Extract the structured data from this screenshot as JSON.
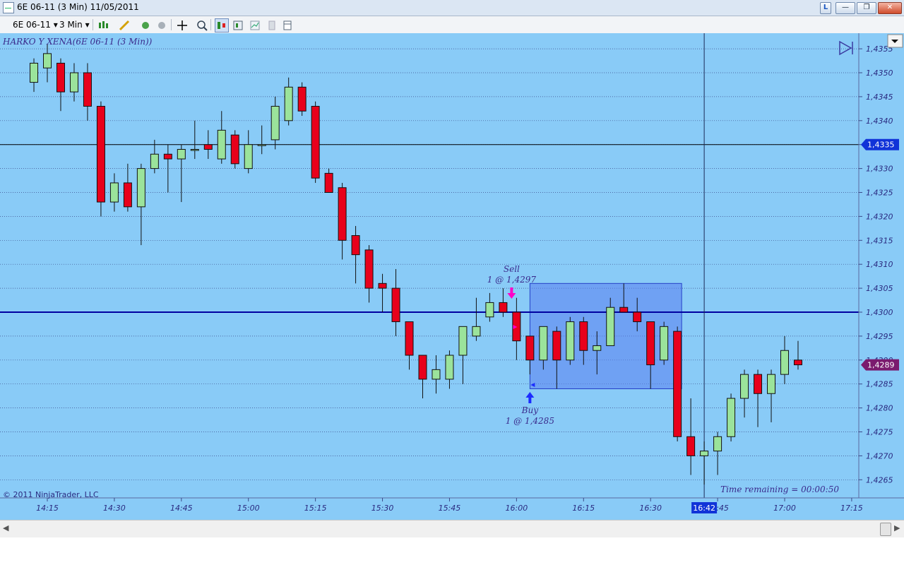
{
  "window": {
    "title": "6E 06-11 (3 Min)  11/05/2011",
    "buttons": {
      "l": "L",
      "minimize": "—",
      "restore": "❐",
      "close": "✕"
    }
  },
  "toolbar": {
    "instrument": "6E 06-11",
    "interval": "3 Min",
    "dropdown_arrow": "▾"
  },
  "chart": {
    "label": "HARKO Y XENA(6E 06-11 (3 Min))",
    "copyright": "© 2011 NinjaTrader, LLC",
    "time_remaining": "Time remaining = 00:00:50",
    "crosshair_time_tag": "16:42",
    "price_tags": {
      "black_line": "1,4335",
      "last_price": "1,4289"
    },
    "y_ticks": [
      "1,4355",
      "1,4350",
      "1,4345",
      "1,4340",
      "1,4335",
      "1,4330",
      "1,4325",
      "1,4320",
      "1,4315",
      "1,4310",
      "1,4305",
      "1,4300",
      "1,4295",
      "1,4290",
      "1,4285",
      "1,4280",
      "1,4275",
      "1,4270",
      "1,4265"
    ],
    "x_ticks": [
      "14:15",
      "14:30",
      "14:45",
      "15:00",
      "15:15",
      "15:30",
      "15:45",
      "16:00",
      "16:15",
      "16:30",
      "16:45",
      "17:00",
      "17:15"
    ],
    "sell_marker": {
      "title": "Sell",
      "detail": "1 @ 1,4297"
    },
    "buy_marker": {
      "title": "Buy",
      "detail": "1 @ 1,4285"
    },
    "colors": {
      "background": "#89cbf7",
      "up_candle": "#9be39b",
      "down_candle": "#e8001b",
      "horizontal_line_black": "#000000",
      "horizontal_line_blue": "#0000a0",
      "zone_fill": "#5a7ff0",
      "price_tag_blue": "#1033d8",
      "price_tag_purple": "#7a1a6e",
      "sell_arrow": "#ff00c8",
      "buy_arrow": "#1c2cff",
      "text_purple": "#3a2a8c"
    }
  },
  "chart_data": {
    "type": "candlestick",
    "x_start": "14:12",
    "x_step_minutes": 3,
    "y_range": [
      1.42625,
      1.43575
    ],
    "horizontal_lines": [
      1.4335,
      1.43
    ],
    "zone": {
      "start": "16:03",
      "end": "16:36",
      "low": 1.4284,
      "high": 1.4306
    },
    "candles": [
      {
        "t": "14:12",
        "o": 1.4348,
        "h": 1.4353,
        "l": 1.4346,
        "c": 1.4352
      },
      {
        "t": "14:15",
        "o": 1.4351,
        "h": 1.4356,
        "l": 1.4348,
        "c": 1.4354
      },
      {
        "t": "14:18",
        "o": 1.4352,
        "h": 1.4353,
        "l": 1.4342,
        "c": 1.4346
      },
      {
        "t": "14:21",
        "o": 1.4346,
        "h": 1.4352,
        "l": 1.4344,
        "c": 1.435
      },
      {
        "t": "14:24",
        "o": 1.435,
        "h": 1.4352,
        "l": 1.434,
        "c": 1.4343
      },
      {
        "t": "14:27",
        "o": 1.4343,
        "h": 1.4344,
        "l": 1.432,
        "c": 1.4323
      },
      {
        "t": "14:30",
        "o": 1.4323,
        "h": 1.4329,
        "l": 1.4321,
        "c": 1.4327
      },
      {
        "t": "14:33",
        "o": 1.4327,
        "h": 1.4331,
        "l": 1.4321,
        "c": 1.4322
      },
      {
        "t": "14:36",
        "o": 1.4322,
        "h": 1.4331,
        "l": 1.4314,
        "c": 1.433
      },
      {
        "t": "14:39",
        "o": 1.433,
        "h": 1.4336,
        "l": 1.4329,
        "c": 1.4333
      },
      {
        "t": "14:42",
        "o": 1.4333,
        "h": 1.4335,
        "l": 1.4325,
        "c": 1.4332
      },
      {
        "t": "14:45",
        "o": 1.4332,
        "h": 1.4335,
        "l": 1.4323,
        "c": 1.4334
      },
      {
        "t": "14:48",
        "o": 1.4334,
        "h": 1.434,
        "l": 1.4332,
        "c": 1.4334
      },
      {
        "t": "14:51",
        "o": 1.4335,
        "h": 1.4338,
        "l": 1.4332,
        "c": 1.4334
      },
      {
        "t": "14:54",
        "o": 1.4332,
        "h": 1.4342,
        "l": 1.4331,
        "c": 1.4338
      },
      {
        "t": "14:57",
        "o": 1.4337,
        "h": 1.4338,
        "l": 1.433,
        "c": 1.4331
      },
      {
        "t": "15:00",
        "o": 1.433,
        "h": 1.4338,
        "l": 1.4329,
        "c": 1.4335
      },
      {
        "t": "15:03",
        "o": 1.4335,
        "h": 1.4339,
        "l": 1.4333,
        "c": 1.4335
      },
      {
        "t": "15:06",
        "o": 1.4336,
        "h": 1.4345,
        "l": 1.4334,
        "c": 1.4343
      },
      {
        "t": "15:09",
        "o": 1.434,
        "h": 1.4349,
        "l": 1.4339,
        "c": 1.4347
      },
      {
        "t": "15:12",
        "o": 1.4347,
        "h": 1.4348,
        "l": 1.4341,
        "c": 1.4342
      },
      {
        "t": "15:15",
        "o": 1.4343,
        "h": 1.4344,
        "l": 1.4327,
        "c": 1.4328
      },
      {
        "t": "15:18",
        "o": 1.4329,
        "h": 1.433,
        "l": 1.4325,
        "c": 1.4325
      },
      {
        "t": "15:21",
        "o": 1.4326,
        "h": 1.4327,
        "l": 1.4311,
        "c": 1.4315
      },
      {
        "t": "15:24",
        "o": 1.4316,
        "h": 1.4318,
        "l": 1.4306,
        "c": 1.4312
      },
      {
        "t": "15:27",
        "o": 1.4313,
        "h": 1.4314,
        "l": 1.4302,
        "c": 1.4305
      },
      {
        "t": "15:30",
        "o": 1.4306,
        "h": 1.4308,
        "l": 1.43,
        "c": 1.4305
      },
      {
        "t": "15:33",
        "o": 1.4305,
        "h": 1.4309,
        "l": 1.4295,
        "c": 1.4298
      },
      {
        "t": "15:36",
        "o": 1.4298,
        "h": 1.4298,
        "l": 1.4288,
        "c": 1.4291
      },
      {
        "t": "15:39",
        "o": 1.4291,
        "h": 1.4291,
        "l": 1.4282,
        "c": 1.4286
      },
      {
        "t": "15:42",
        "o": 1.4286,
        "h": 1.4291,
        "l": 1.4283,
        "c": 1.4288
      },
      {
        "t": "15:45",
        "o": 1.4286,
        "h": 1.4292,
        "l": 1.4284,
        "c": 1.4291
      },
      {
        "t": "15:48",
        "o": 1.4291,
        "h": 1.4297,
        "l": 1.4285,
        "c": 1.4297
      },
      {
        "t": "15:51",
        "o": 1.4295,
        "h": 1.4303,
        "l": 1.4294,
        "c": 1.4297
      },
      {
        "t": "15:54",
        "o": 1.4299,
        "h": 1.4304,
        "l": 1.4298,
        "c": 1.4302
      },
      {
        "t": "15:57",
        "o": 1.4302,
        "h": 1.4305,
        "l": 1.4299,
        "c": 1.43
      },
      {
        "t": "16:00",
        "o": 1.43,
        "h": 1.4303,
        "l": 1.429,
        "c": 1.4294
      },
      {
        "t": "16:03",
        "o": 1.4295,
        "h": 1.4295,
        "l": 1.4287,
        "c": 1.429
      },
      {
        "t": "16:06",
        "o": 1.429,
        "h": 1.4297,
        "l": 1.4288,
        "c": 1.4297
      },
      {
        "t": "16:09",
        "o": 1.4296,
        "h": 1.4297,
        "l": 1.4284,
        "c": 1.429
      },
      {
        "t": "16:12",
        "o": 1.429,
        "h": 1.4299,
        "l": 1.4289,
        "c": 1.4298
      },
      {
        "t": "16:15",
        "o": 1.4298,
        "h": 1.4299,
        "l": 1.4289,
        "c": 1.4292
      },
      {
        "t": "16:18",
        "o": 1.4292,
        "h": 1.4296,
        "l": 1.4287,
        "c": 1.4293
      },
      {
        "t": "16:21",
        "o": 1.4293,
        "h": 1.4303,
        "l": 1.4293,
        "c": 1.4301
      },
      {
        "t": "16:24",
        "o": 1.4301,
        "h": 1.4306,
        "l": 1.43,
        "c": 1.43
      },
      {
        "t": "16:27",
        "o": 1.43,
        "h": 1.4303,
        "l": 1.4296,
        "c": 1.4298
      },
      {
        "t": "16:30",
        "o": 1.4298,
        "h": 1.4298,
        "l": 1.4284,
        "c": 1.4289
      },
      {
        "t": "16:33",
        "o": 1.429,
        "h": 1.4298,
        "l": 1.4289,
        "c": 1.4297
      },
      {
        "t": "16:36",
        "o": 1.4296,
        "h": 1.4297,
        "l": 1.4273,
        "c": 1.4274
      },
      {
        "t": "16:39",
        "o": 1.4274,
        "h": 1.4282,
        "l": 1.4266,
        "c": 1.427
      },
      {
        "t": "16:42",
        "o": 1.427,
        "h": 1.4273,
        "l": 1.4264,
        "c": 1.4271
      },
      {
        "t": "16:45",
        "o": 1.4271,
        "h": 1.4275,
        "l": 1.4266,
        "c": 1.4274
      },
      {
        "t": "16:48",
        "o": 1.4274,
        "h": 1.4283,
        "l": 1.4273,
        "c": 1.4282
      },
      {
        "t": "16:51",
        "o": 1.4282,
        "h": 1.4288,
        "l": 1.4278,
        "c": 1.4287
      },
      {
        "t": "16:54",
        "o": 1.4287,
        "h": 1.4288,
        "l": 1.4276,
        "c": 1.4283
      },
      {
        "t": "16:57",
        "o": 1.4283,
        "h": 1.4288,
        "l": 1.4277,
        "c": 1.4287
      },
      {
        "t": "17:00",
        "o": 1.4287,
        "h": 1.4295,
        "l": 1.4285,
        "c": 1.4292
      },
      {
        "t": "17:03",
        "o": 1.429,
        "h": 1.4294,
        "l": 1.4288,
        "c": 1.4289
      }
    ]
  }
}
